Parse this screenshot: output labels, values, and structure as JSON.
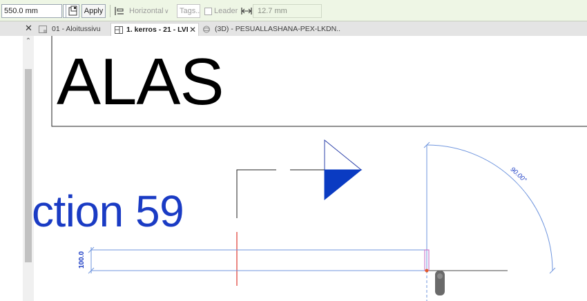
{
  "options_bar": {
    "length_value": "550.0 mm",
    "apply_label": "Apply",
    "orientation_value": "Horizontal",
    "tags_placeholder": "Tags...",
    "leader_label": "Leader",
    "leader_length": "12.7 mm"
  },
  "tabs": [
    {
      "label": "01 - Aloitussivu",
      "active": false
    },
    {
      "label": "1. kerros - 21 - LVI",
      "active": true
    },
    {
      "label": "(3D) - PESUALLASHANA-PEX-LKDN...",
      "active": false
    }
  ],
  "canvas": {
    "title_text": "ALAS",
    "section_text": "ction 59",
    "dimension_text": "100.0",
    "angle_text": "90.00°",
    "colors": {
      "annotation_blue": "#1a3bc4",
      "line_blue": "#6f95de",
      "red_line": "#e0453d"
    }
  }
}
